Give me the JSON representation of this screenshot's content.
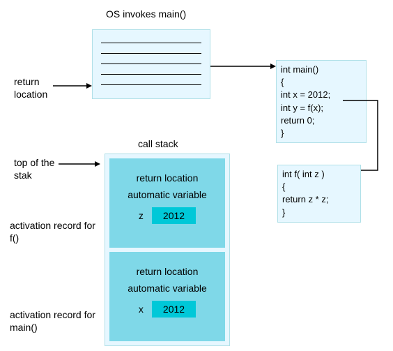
{
  "title": "OS invokes main()",
  "labels": {
    "return_location": "return location",
    "call_stack": "call stack",
    "top_of_stack": "top of the stak",
    "activation_f": "activation record for f()",
    "activation_main": "activation record for main()"
  },
  "code": {
    "main": {
      "sig": "int main()",
      "open": "{",
      "l1": " int x = 2012;",
      "l2": " int y = f(x);",
      "l3": " return 0;",
      "close": "}"
    },
    "f": {
      "sig": "int f( int z )",
      "open": "{",
      "l1": " return z * z;",
      "close": "}"
    }
  },
  "stack": {
    "records": [
      {
        "return_loc": "return location",
        "auto_var": "automatic variable",
        "var_name": "z",
        "var_value": "2012"
      },
      {
        "return_loc": "return location",
        "auto_var": "automatic variable",
        "var_name": "x",
        "var_value": "2012"
      }
    ]
  }
}
